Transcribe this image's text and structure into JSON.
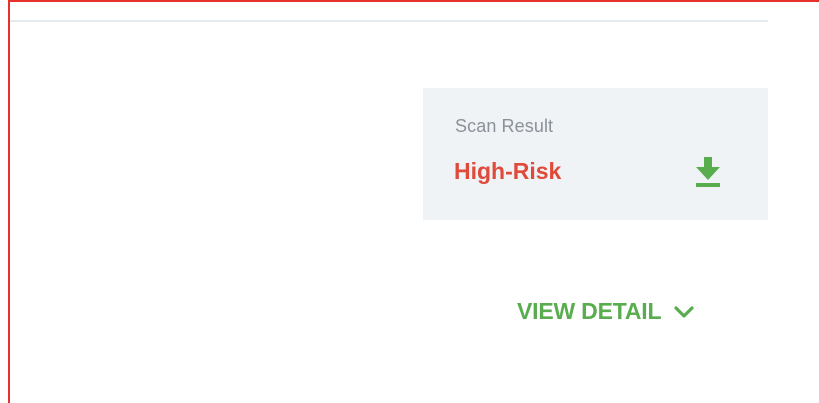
{
  "scan_result": {
    "label": "Scan Result",
    "value": "High-Risk",
    "value_color": "#e04a3a",
    "download_icon": "download-icon"
  },
  "details": {
    "toggle_label": "VIEW DETAIL",
    "toggle_icon": "chevron-down-icon",
    "accent_color": "#5aad4e"
  },
  "frame_color": "#e8302c"
}
